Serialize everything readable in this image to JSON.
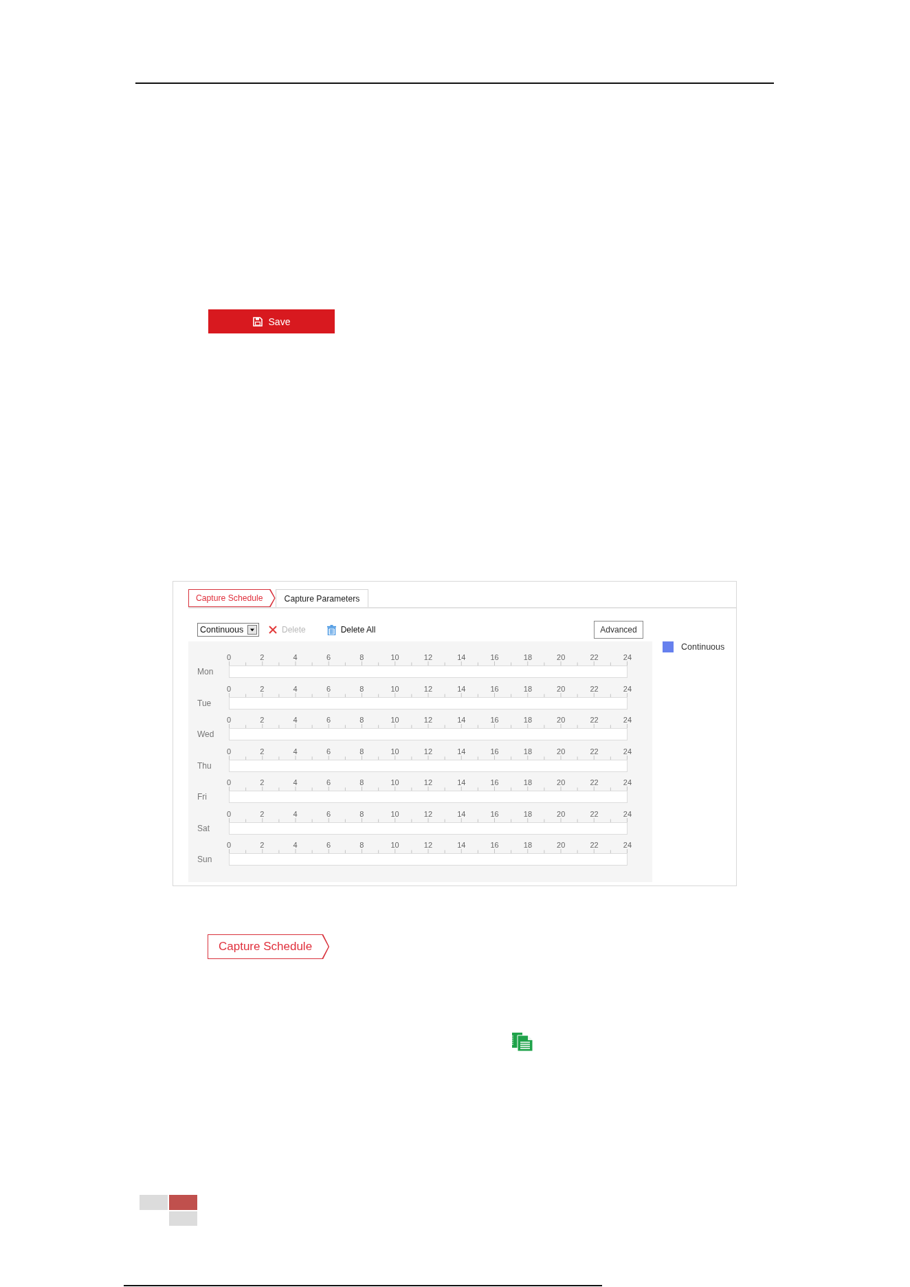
{
  "save_button": {
    "label": "Save"
  },
  "schedule_panel": {
    "tabs": [
      {
        "label": "Capture Schedule",
        "selected": true
      },
      {
        "label": "Capture Parameters",
        "selected": false
      }
    ],
    "toolbar": {
      "mode_select": {
        "value": "Continuous"
      },
      "delete_button": {
        "label": "Delete",
        "disabled": true
      },
      "delete_all_button": {
        "label": "Delete All",
        "disabled": false
      },
      "advanced_button": {
        "label": "Advanced"
      }
    },
    "days": [
      {
        "label": "Mon",
        "hour_labels": [
          "0",
          "2",
          "4",
          "6",
          "8",
          "10",
          "12",
          "14",
          "16",
          "18",
          "20",
          "22",
          "24"
        ]
      },
      {
        "label": "Tue",
        "hour_labels": [
          "0",
          "2",
          "4",
          "6",
          "8",
          "10",
          "12",
          "14",
          "16",
          "18",
          "20",
          "22",
          "24"
        ]
      },
      {
        "label": "Wed",
        "hour_labels": [
          "0",
          "2",
          "4",
          "6",
          "8",
          "10",
          "12",
          "14",
          "16",
          "18",
          "20",
          "22",
          "24"
        ]
      },
      {
        "label": "Thu",
        "hour_labels": [
          "0",
          "2",
          "4",
          "6",
          "8",
          "10",
          "12",
          "14",
          "16",
          "18",
          "20",
          "22",
          "24"
        ]
      },
      {
        "label": "Fri",
        "hour_labels": [
          "0",
          "2",
          "4",
          "6",
          "8",
          "10",
          "12",
          "14",
          "16",
          "18",
          "20",
          "22",
          "24"
        ]
      },
      {
        "label": "Sat",
        "hour_labels": [
          "0",
          "2",
          "4",
          "6",
          "8",
          "10",
          "12",
          "14",
          "16",
          "18",
          "20",
          "22",
          "24"
        ]
      },
      {
        "label": "Sun",
        "hour_labels": [
          "0",
          "2",
          "4",
          "6",
          "8",
          "10",
          "12",
          "14",
          "16",
          "18",
          "20",
          "22",
          "24"
        ]
      }
    ],
    "legend": [
      {
        "label": "Continuous",
        "color": "#6680ee"
      }
    ]
  },
  "tab_figure": {
    "label": "Capture Schedule",
    "selected": true
  }
}
